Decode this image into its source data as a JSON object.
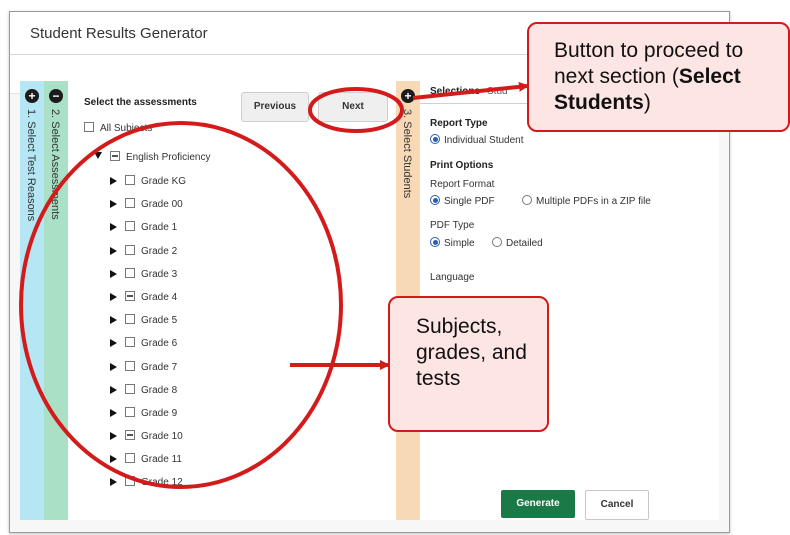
{
  "window": {
    "title": "Student Results Generator"
  },
  "steps": [
    {
      "icon": "plus-circle-icon",
      "label": "1. Select Test Reasons"
    },
    {
      "icon": "minus-circle-icon",
      "label": "2. Select Assessments"
    },
    {
      "icon": "plus-circle-icon",
      "label": "3. Select Students"
    }
  ],
  "assessments": {
    "title": "Select the assessments",
    "previous_label": "Previous",
    "next_label": "Next",
    "all_subjects_label": "All Subjects",
    "subject_label": "English Proficiency",
    "grades": [
      {
        "label": "Grade KG",
        "state": "unchecked"
      },
      {
        "label": "Grade 00",
        "state": "unchecked"
      },
      {
        "label": "Grade 1",
        "state": "unchecked"
      },
      {
        "label": "Grade 2",
        "state": "unchecked"
      },
      {
        "label": "Grade 3",
        "state": "unchecked"
      },
      {
        "label": "Grade 4",
        "state": "partial"
      },
      {
        "label": "Grade 5",
        "state": "unchecked"
      },
      {
        "label": "Grade 6",
        "state": "unchecked"
      },
      {
        "label": "Grade 7",
        "state": "unchecked"
      },
      {
        "label": "Grade 8",
        "state": "unchecked"
      },
      {
        "label": "Grade 9",
        "state": "unchecked"
      },
      {
        "label": "Grade 10",
        "state": "partial"
      },
      {
        "label": "Grade 11",
        "state": "unchecked"
      },
      {
        "label": "Grade 12",
        "state": "unchecked"
      }
    ]
  },
  "right_panel": {
    "tabs": [
      "Selections",
      "Stud"
    ],
    "report_type_heading": "Report Type",
    "report_type_option": "Individual Student",
    "print_options_heading": "Print Options",
    "report_format_label": "Report Format",
    "format_single": "Single PDF",
    "format_multiple": "Multiple PDFs in a ZIP file",
    "pdf_type_label": "PDF Type",
    "pdf_simple": "Simple",
    "pdf_detailed": "Detailed",
    "language_label": "Language",
    "generate_label": "Generate",
    "cancel_label": "Cancel"
  },
  "callouts": {
    "next_prefix": "Button to proceed to next section (",
    "next_bold": "Select Students",
    "next_suffix": ")",
    "subjects_text": "Subjects, grades, and tests"
  },
  "colors": {
    "annotation_red": "#d41b1b",
    "callout_fill": "#fde5e4",
    "step1_blue": "#b4e6f4",
    "step2_green": "#a9e0c6",
    "step3_orange": "#f8d9b6",
    "generate_green": "#1a7a47"
  }
}
